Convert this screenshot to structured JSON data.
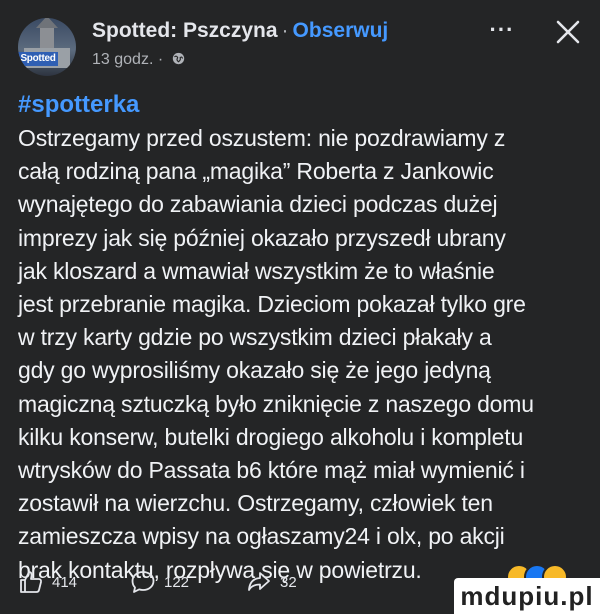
{
  "post": {
    "page_name": "Spotted: Pszczyna",
    "separator": "·",
    "follow_label": "Obserwuj",
    "timestamp": "13 godz.",
    "meta_separator": "·",
    "audience_icon": "globe-icon",
    "avatar_label": "Spotted",
    "more_icon": "more-icon",
    "more_label": "···",
    "close_icon": "close-icon",
    "hashtag": "#spotterka",
    "body_lines": [
      "Ostrzegamy przed oszustem: nie pozdrawiamy z",
      "całą rodziną pana „magika” Roberta z Jankowic",
      "wynajętego do zabawiania dzieci podczas dużej",
      "imprezy jak się później okazało przyszedł ubrany",
      "jak kloszard a wmawiał wszystkim że to właśnie",
      "jest przebranie magika. Dzieciom pokazał tylko gre",
      "w trzy karty gdzie po wszystkim dzieci płakały a",
      "gdy go wyprosiliśmy okazało się że  jego jedyną",
      "magiczną sztuczką było zniknięcie z naszego domu",
      "kilku konserw, butelki drogiego alkoholu i kompletu",
      "wtrysków do Passata b6 które mąż miał wymienić i",
      "zostawił na wierzchu. Ostrzegamy, człowiek ten",
      "zamieszcza wpisy na ogłaszamy24 i olx, po akcji",
      "brak kontaktu, rozpływa się w powietrzu."
    ]
  },
  "actions": {
    "like_count": "414",
    "like_icon": "thumbs-up-icon",
    "comment_count": "122",
    "comment_icon": "comment-icon",
    "share_count": "32",
    "share_icon": "share-icon"
  },
  "reactions": [
    {
      "name": "haha-reaction-icon",
      "color": "#f7b928"
    },
    {
      "name": "like-reaction-icon",
      "color": "#1877f2"
    },
    {
      "name": "wow-reaction-icon",
      "color": "#f7b928"
    }
  ],
  "watermark": "mdupiu.pl",
  "colors": {
    "background": "#242526",
    "accent": "#4599ff",
    "text": "#e4e6eb",
    "secondary_text": "#b0b3b8"
  }
}
